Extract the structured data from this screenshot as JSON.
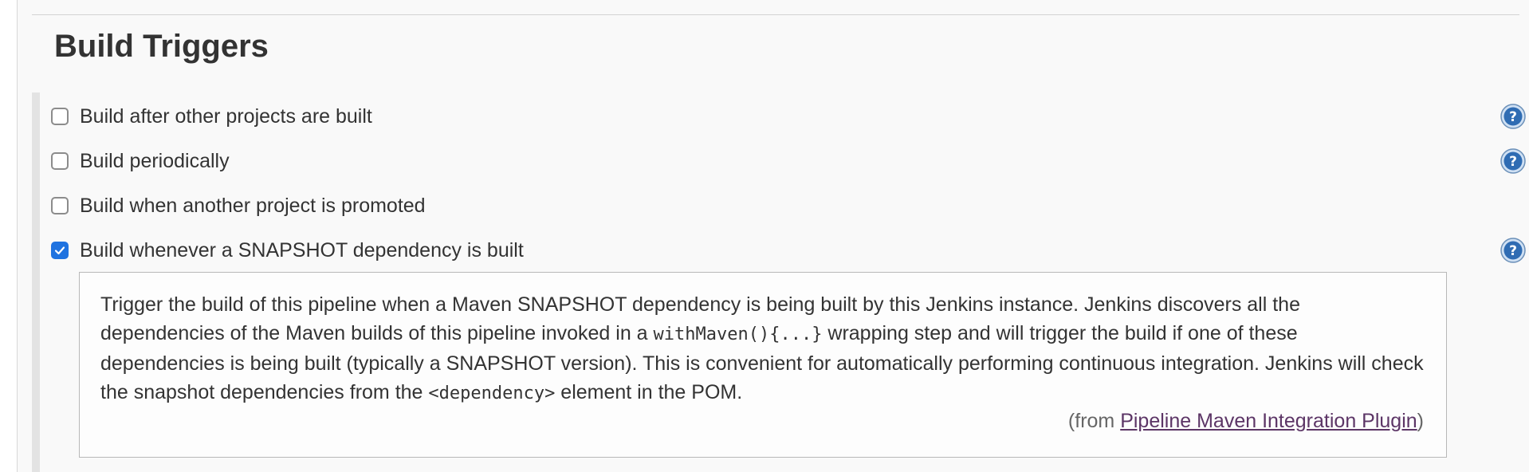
{
  "section": {
    "title": "Build Triggers"
  },
  "triggers": [
    {
      "label": "Build after other projects are built",
      "checked": false,
      "has_help": true
    },
    {
      "label": "Build periodically",
      "checked": false,
      "has_help": true
    },
    {
      "label": "Build when another project is promoted",
      "checked": false,
      "has_help": false
    },
    {
      "label": "Build whenever a SNAPSHOT dependency is built",
      "checked": true,
      "has_help": true
    }
  ],
  "help": {
    "text_1": "Trigger the build of this pipeline when a Maven SNAPSHOT dependency is being built by this Jenkins instance. Jenkins discovers all the dependencies of the Maven builds of this pipeline invoked in a ",
    "code_1": "withMaven(){...}",
    "text_2": " wrapping step and will trigger the build if one of these dependencies is being built (typically a SNAPSHOT version). This is convenient for automatically performing continuous integration. Jenkins will check the snapshot dependencies from the ",
    "code_2": "<dependency>",
    "text_3": " element in the POM.",
    "from_prefix": "(from ",
    "from_link": "Pipeline Maven Integration Plugin",
    "from_suffix": ")"
  },
  "icons": {
    "help": "help-question-icon",
    "check": "checkmark-icon"
  },
  "colors": {
    "help_icon": "#2b6cb0",
    "checkbox_checked": "#1f73e0",
    "link": "#5c3566"
  }
}
